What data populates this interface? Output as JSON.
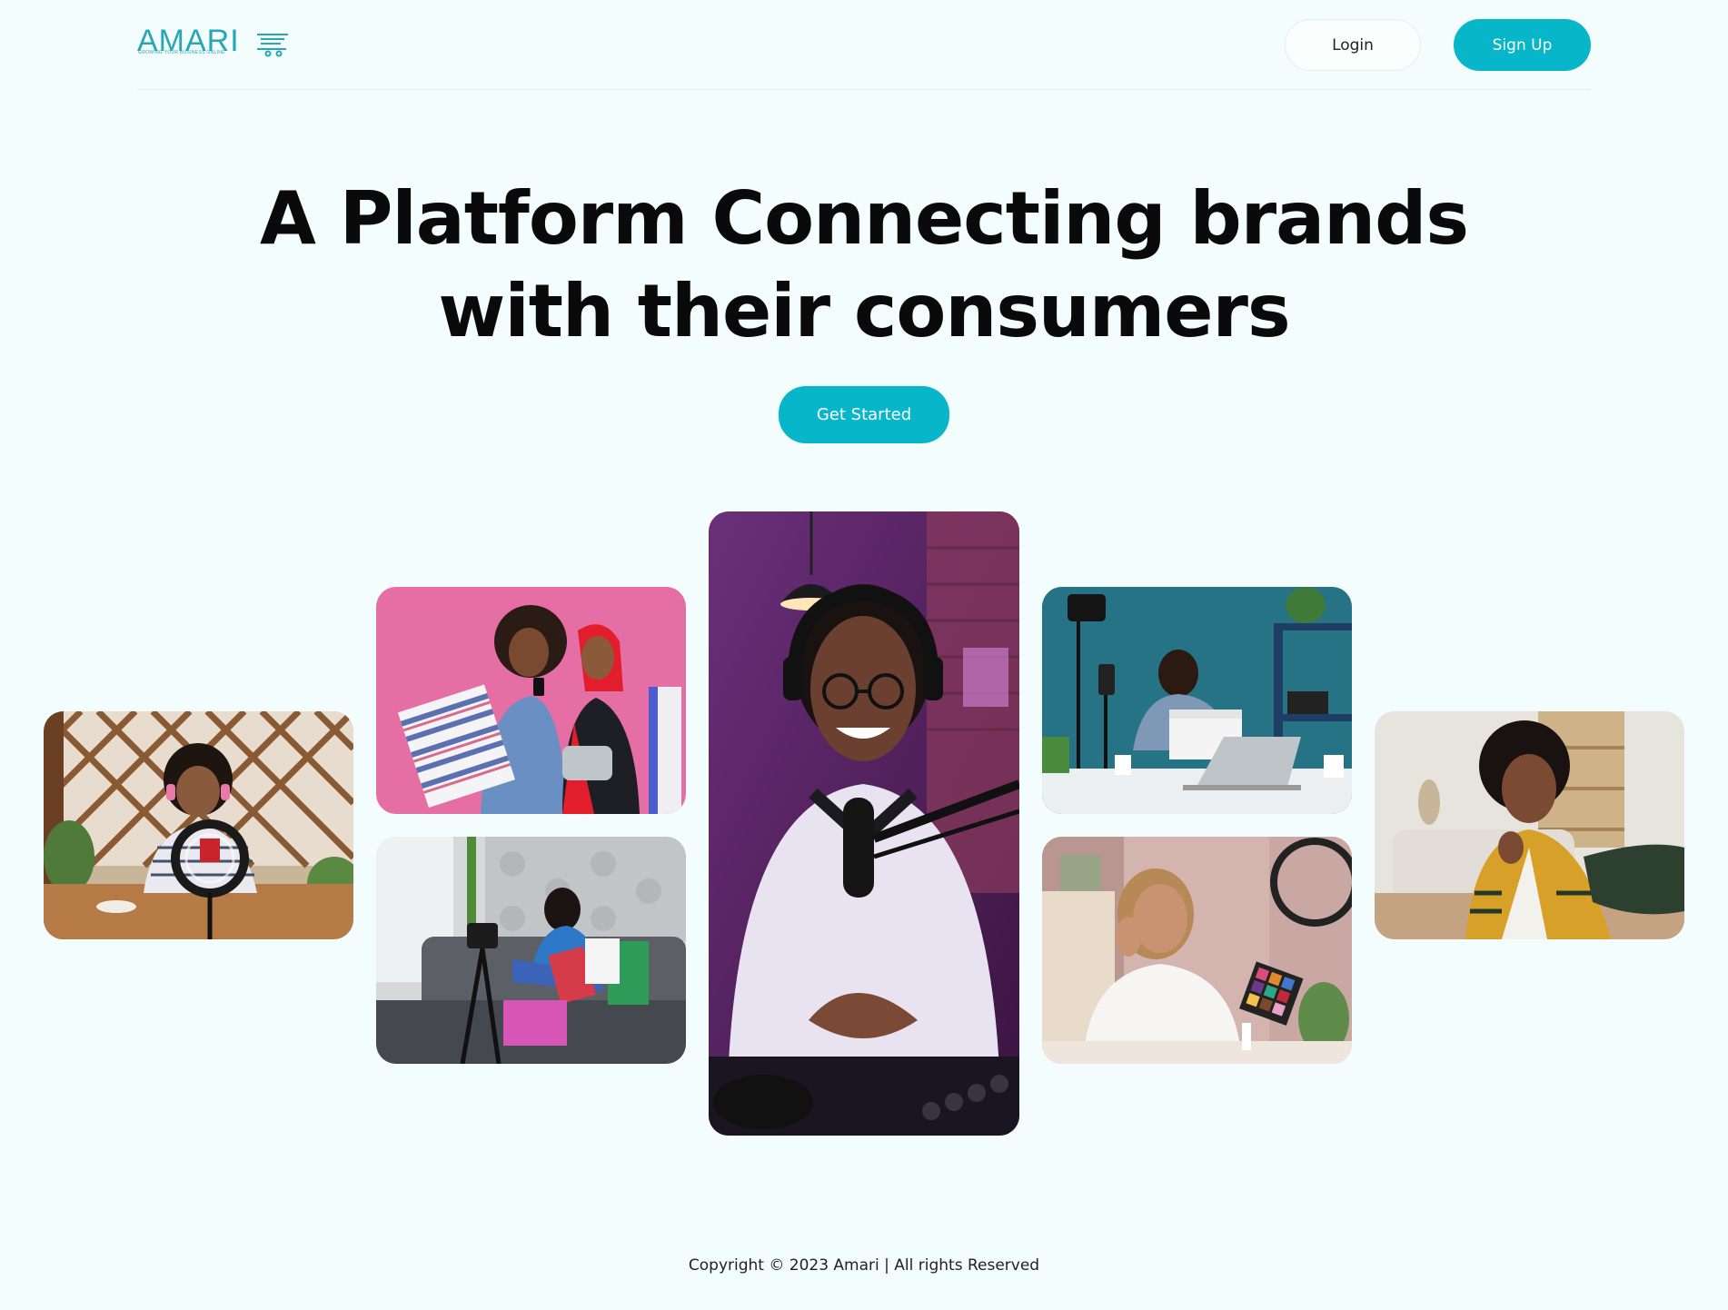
{
  "header": {
    "logo": {
      "wordmark": "AMARI",
      "tagline": "GROWING YOUR BUSINESS ONLINE"
    },
    "login_label": "Login",
    "signup_label": "Sign Up"
  },
  "hero": {
    "title_line1": "A Platform Connecting brands",
    "title_line2": "with their consumers",
    "cta_label": "Get Started"
  },
  "gallery": {
    "photos": [
      {
        "subject": "woman with headphones recording with ring light at cafe table"
      },
      {
        "subject": "two women with shopping bags against pink wall"
      },
      {
        "subject": "woman on sofa with shopping bags filmed by camera"
      },
      {
        "subject": "smiling man with headphones and microphone podcast studio"
      },
      {
        "subject": "man unboxing product in front of phone on tripod"
      },
      {
        "subject": "woman applying makeup with ring light"
      },
      {
        "subject": "woman taking selfie in living room"
      }
    ]
  },
  "footer": {
    "copyright": "Copyright © 2023 Amari | All rights Reserved"
  },
  "colors": {
    "accent": "#07b6c8",
    "background": "#f3fdfd",
    "logo": "#27a7b3"
  }
}
